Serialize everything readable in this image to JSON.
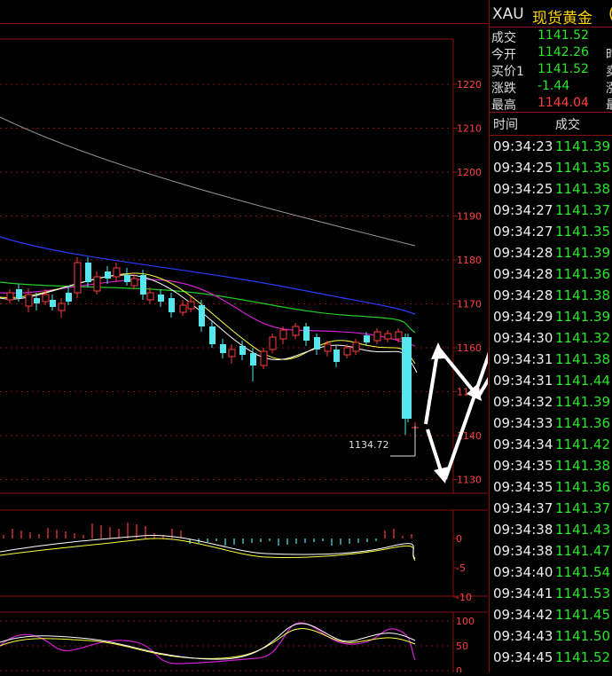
{
  "instrument": {
    "symbol": "XAU",
    "name": "现货黄金",
    "name_trail": "("
  },
  "quote": [
    {
      "label": "成交",
      "value": "1141.52",
      "extra": "",
      "color": "#27e627"
    },
    {
      "label": "今开",
      "value": "1142.26",
      "extra": "时",
      "color": "#27e627"
    },
    {
      "label": "买价1",
      "value": "1141.52",
      "extra": "卖",
      "color": "#27e627"
    },
    {
      "label": "涨跌",
      "value": "-1.44",
      "extra": "涨",
      "color": "#27e627"
    },
    {
      "label": "最高",
      "value": "1144.04",
      "extra": "最",
      "color": "#ff4040"
    }
  ],
  "ticks_header": {
    "time": "时间",
    "price": "成交"
  },
  "ticks": [
    {
      "time": "09:34:23",
      "price": "1141.39"
    },
    {
      "time": "09:34:25",
      "price": "1141.35"
    },
    {
      "time": "09:34:25",
      "price": "1141.38"
    },
    {
      "time": "09:34:27",
      "price": "1141.37"
    },
    {
      "time": "09:34:27",
      "price": "1141.35"
    },
    {
      "time": "09:34:28",
      "price": "1141.39"
    },
    {
      "time": "09:34:28",
      "price": "1141.36"
    },
    {
      "time": "09:34:28",
      "price": "1141.38"
    },
    {
      "time": "09:34:29",
      "price": "1141.39"
    },
    {
      "time": "09:34:30",
      "price": "1141.32"
    },
    {
      "time": "09:34:31",
      "price": "1141.38"
    },
    {
      "time": "09:34:31",
      "price": "1141.44"
    },
    {
      "time": "09:34:32",
      "price": "1141.39"
    },
    {
      "time": "09:34:33",
      "price": "1141.36"
    },
    {
      "time": "09:34:34",
      "price": "1141.42"
    },
    {
      "time": "09:34:35",
      "price": "1141.38"
    },
    {
      "time": "09:34:35",
      "price": "1141.36"
    },
    {
      "time": "09:34:37",
      "price": "1141.37"
    },
    {
      "time": "09:34:38",
      "price": "1141.43"
    },
    {
      "time": "09:34:38",
      "price": "1141.47"
    },
    {
      "time": "09:34:40",
      "price": "1141.54"
    },
    {
      "time": "09:34:41",
      "price": "1141.53"
    },
    {
      "time": "09:34:42",
      "price": "1141.45"
    },
    {
      "time": "09:34:43",
      "price": "1141.50"
    },
    {
      "time": "09:34:45",
      "price": "1141.52"
    }
  ],
  "price_axis": [
    "1220",
    "1210",
    "1200",
    "1190",
    "1180",
    "1170",
    "1160",
    "1150",
    "1140",
    "1130"
  ],
  "macd_axis": [
    "0",
    "-5",
    "-10"
  ],
  "kdj_axis": [
    "100",
    "50",
    "0"
  ],
  "low_label": "1134.72",
  "colors": {
    "up": "#ff3b3b",
    "down": "#55e6ee",
    "grid": "#8a1010"
  }
}
